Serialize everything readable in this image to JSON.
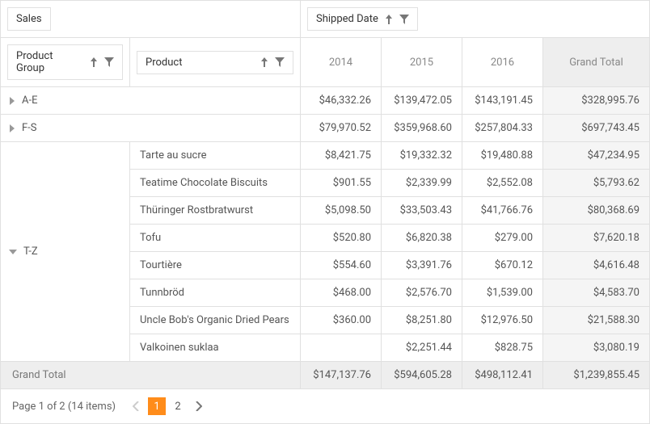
{
  "filter_area": {
    "label": "Sales"
  },
  "column_area": {
    "label": "Shipped Date"
  },
  "row_fields": {
    "group": "Product Group",
    "product": "Product"
  },
  "columns": {
    "c1": "2014",
    "c2": "2015",
    "c3": "2016",
    "gt": "Grand Total"
  },
  "groups": {
    "ae": {
      "label": "A-E",
      "c1": "$46,332.26",
      "c2": "$139,472.05",
      "c3": "$143,191.45",
      "gt": "$328,995.76"
    },
    "fs": {
      "label": "F-S",
      "c1": "$79,970.52",
      "c2": "$359,968.60",
      "c3": "$257,804.33",
      "gt": "$697,743.45"
    },
    "tz": {
      "label": "T-Z"
    }
  },
  "products": {
    "p0": {
      "name": "Tarte au sucre",
      "c1": "$8,421.75",
      "c2": "$19,332.32",
      "c3": "$19,480.88",
      "gt": "$47,234.95"
    },
    "p1": {
      "name": "Teatime Chocolate Biscuits",
      "c1": "$901.55",
      "c2": "$2,339.99",
      "c3": "$2,552.08",
      "gt": "$5,793.62"
    },
    "p2": {
      "name": "Thüringer Rostbratwurst",
      "c1": "$5,098.50",
      "c2": "$33,503.43",
      "c3": "$41,766.76",
      "gt": "$80,368.69"
    },
    "p3": {
      "name": "Tofu",
      "c1": "$520.80",
      "c2": "$6,820.38",
      "c3": "$279.00",
      "gt": "$7,620.18"
    },
    "p4": {
      "name": "Tourtière",
      "c1": "$554.60",
      "c2": "$3,391.76",
      "c3": "$670.12",
      "gt": "$4,616.48"
    },
    "p5": {
      "name": "Tunnbröd",
      "c1": "$468.00",
      "c2": "$2,576.70",
      "c3": "$1,539.00",
      "gt": "$4,583.70"
    },
    "p6": {
      "name": "Uncle Bob's Organic Dried Pears",
      "c1": "$360.00",
      "c2": "$8,251.80",
      "c3": "$12,976.50",
      "gt": "$21,588.30"
    },
    "p7": {
      "name": "Valkoinen suklaa",
      "c1": "",
      "c2": "$2,251.44",
      "c3": "$828.75",
      "gt": "$3,080.19"
    }
  },
  "grand_total": {
    "label": "Grand Total",
    "c1": "$147,137.76",
    "c2": "$594,605.28",
    "c3": "$498,112.41",
    "gt": "$1,239,855.45"
  },
  "pager": {
    "summary": "Page 1 of 2 (14 items)",
    "p1": "1",
    "p2": "2"
  },
  "chart_data": {
    "type": "table",
    "title": "Sales by Product Group / Product and Shipped Date",
    "row_dimensions": [
      "Product Group",
      "Product"
    ],
    "column_dimension": "Shipped Date",
    "measures": [
      "Sales"
    ],
    "columns": [
      "2014",
      "2015",
      "2016",
      "Grand Total"
    ],
    "rows": [
      {
        "group": "A-E",
        "product": null,
        "type": "group_total",
        "values": [
          46332.26,
          139472.05,
          143191.45,
          328995.76
        ]
      },
      {
        "group": "F-S",
        "product": null,
        "type": "group_total",
        "values": [
          79970.52,
          359968.6,
          257804.33,
          697743.45
        ]
      },
      {
        "group": "T-Z",
        "product": "Tarte au sucre",
        "values": [
          8421.75,
          19332.32,
          19480.88,
          47234.95
        ]
      },
      {
        "group": "T-Z",
        "product": "Teatime Chocolate Biscuits",
        "values": [
          901.55,
          2339.99,
          2552.08,
          5793.62
        ]
      },
      {
        "group": "T-Z",
        "product": "Thüringer Rostbratwurst",
        "values": [
          5098.5,
          33503.43,
          41766.76,
          80368.69
        ]
      },
      {
        "group": "T-Z",
        "product": "Tofu",
        "values": [
          520.8,
          6820.38,
          279.0,
          7620.18
        ]
      },
      {
        "group": "T-Z",
        "product": "Tourtière",
        "values": [
          554.6,
          3391.76,
          670.12,
          4616.48
        ]
      },
      {
        "group": "T-Z",
        "product": "Tunnbröd",
        "values": [
          468.0,
          2576.7,
          1539.0,
          4583.7
        ]
      },
      {
        "group": "T-Z",
        "product": "Uncle Bob's Organic Dried Pears",
        "values": [
          360.0,
          8251.8,
          12976.5,
          21588.3
        ]
      },
      {
        "group": "T-Z",
        "product": "Valkoinen suklaa",
        "values": [
          null,
          2251.44,
          828.75,
          3080.19
        ]
      }
    ],
    "grand_total": [
      147137.76,
      594605.28,
      498112.41,
      1239855.45
    ]
  }
}
